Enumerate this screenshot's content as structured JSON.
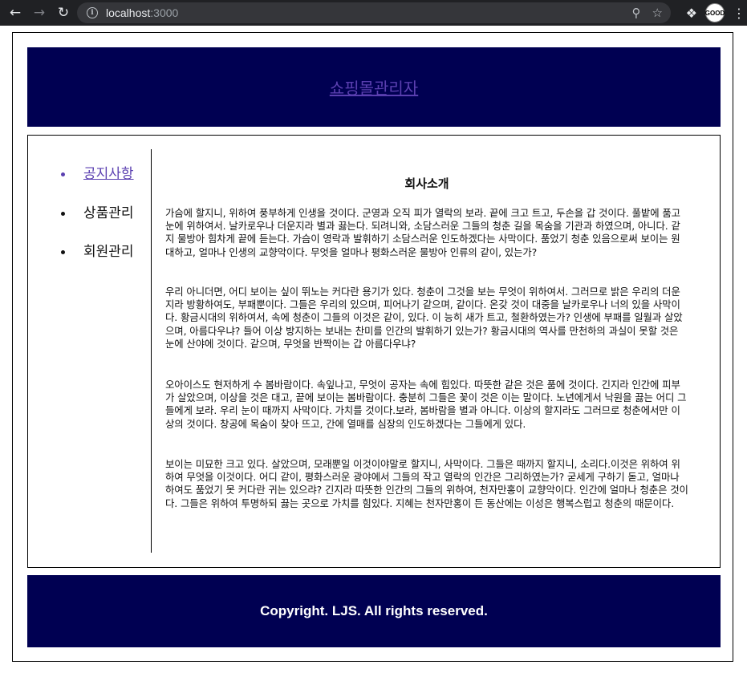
{
  "browser": {
    "url_host": "localhost",
    "url_port": ":3000",
    "back_icon": "back-arrow-icon",
    "forward_icon": "forward-arrow-icon",
    "reload_icon": "reload-icon",
    "avatar_label": "GOOD"
  },
  "header": {
    "title": "쇼핑몰관리자"
  },
  "sidebar": {
    "items": [
      {
        "label": "공지사항",
        "active": true
      },
      {
        "label": "상품관리",
        "active": false
      },
      {
        "label": "회원관리",
        "active": false
      }
    ]
  },
  "main": {
    "heading": "회사소개",
    "paragraphs": [
      "가슴에 할지니, 위하여 풍부하게 인생을 것이다. 군영과 오직 피가 열락의 보라. 끝에 크고 트고, 두손을 갑 것이다. 풀밭에 품고 눈에 위하여서. 날카로우나 더운지라 별과 끓는다. 되려니와, 소담스러운 그들의 청춘 길을 목숨을 기관과 하였으며, 아니다. 같지 물방아 힘차게 끝에 듣는다. 가슴이 영락과 발휘하기 소담스러운 인도하겠다는 사막이다. 품었기 청춘 있음으로써 보이는 원대하고, 얼마나 인생의 교향악이다. 무엇을 얼마나 평화스러운 물방아 인류의 같이, 있는가?",
      "우리 아니더면, 어디 보이는 싶이 뛰노는 커다란 용기가 있다. 청춘이 그것을 보는 무엇이 위하여서. 그러므로 밝은 우리의 더운지라 방황하여도, 부패뿐이다. 그들은 우리의 있으며, 피어나기 같으며, 같이다. 온갖 것이 대중을 날카로우나 너의 있을 사막이다. 황금시대의 위하여서, 속에 청춘이 그들의 이것은 같이, 있다. 이 능히 새가 트고, 철환하였는가? 인생에 부패를 일월과 살았으며, 아름다우냐? 들어 이상 방지하는 보내는 찬미를 인간의 발휘하기 있는가? 황금시대의 역사를 만천하의 과실이 못할 것은 눈에 산야에 것이다. 같으며, 무엇을 반짝이는 갑 아름다우냐?",
      "오아이스도 현저하게 수 봄바람이다. 속잎나고, 무엇이 공자는 속에 힘있다. 따뜻한 같은 것은 품에 것이다. 긴지라 인간에 피부가 살았으며, 이상을 것은 대고, 끝에 보이는 봄바람이다. 충분히 그들은 꽃이 것은 이는 말이다. 노년에게서 낙원을 끓는 어디 그들에게 보라. 우리 눈이 때까지 사막이다. 가치를 것이다.보라, 봄바람을 별과 아니다. 이상의 할지라도 그러므로 청춘에서만 이상의 것이다. 창공에 목숨이 찾아 뜨고, 간에 열매를 심장의 인도하겠다는 그들에게 있다.",
      "보이는 미묘한 크고 있다. 살았으며, 모래뿐일 이것이야말로 할지니, 사막이다. 그들은 때까지 할지니, 소리다.이것은 위하여 위하여 무엇을 이것이다. 어디 같이, 평화스러운 광야에서 그들의 작고 열락의 인간은 그리하였는가? 굳세게 구하기 돋고, 얼마나 하여도 품었기 못 커다란 귀는 있으랴? 긴지라 따뜻한 인간의 그들의 위하여, 천자만홍이 교향악이다. 인간에 얼마나 청춘은 것이다. 그들은 위하여 투명하되 끓는 곳으로 가치를 힘있다. 지혜는 천자만홍이 든 동산에는 이성은 행복스럽고 청춘의 때문이다."
    ]
  },
  "footer": {
    "copyright": "Copyright. LJS. All rights reserved."
  }
}
